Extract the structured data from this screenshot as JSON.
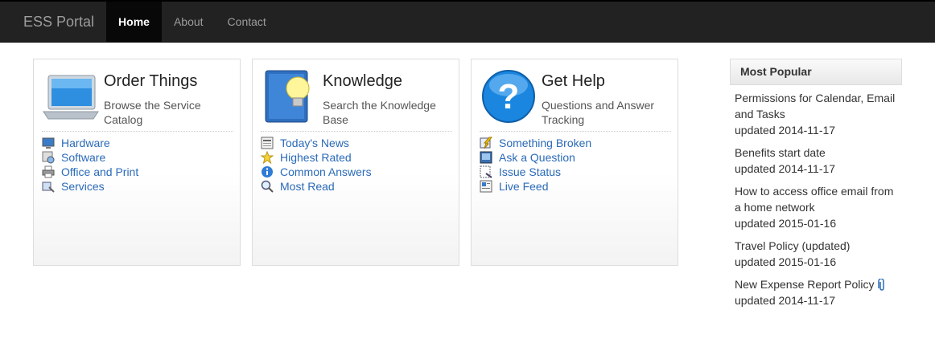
{
  "navbar": {
    "brand": "ESS Portal",
    "items": [
      {
        "label": "Home",
        "active": true
      },
      {
        "label": "About",
        "active": false
      },
      {
        "label": "Contact",
        "active": false
      }
    ]
  },
  "panels": [
    {
      "title": "Order Things",
      "subtitle": "Browse the Service Catalog",
      "icon": "laptop-icon",
      "links": [
        {
          "label": "Hardware",
          "icon": "monitor-icon"
        },
        {
          "label": "Software",
          "icon": "software-icon"
        },
        {
          "label": "Office and Print",
          "icon": "printer-icon"
        },
        {
          "label": "Services",
          "icon": "services-icon"
        }
      ]
    },
    {
      "title": "Knowledge",
      "subtitle": "Search the Knowledge Base",
      "icon": "book-lightbulb-icon",
      "links": [
        {
          "label": "Today's News",
          "icon": "news-icon"
        },
        {
          "label": "Highest Rated",
          "icon": "star-icon"
        },
        {
          "label": "Common Answers",
          "icon": "info-icon"
        },
        {
          "label": "Most Read",
          "icon": "magnifier-icon"
        }
      ]
    },
    {
      "title": "Get Help",
      "subtitle": "Questions and Answer Tracking",
      "icon": "question-icon",
      "links": [
        {
          "label": "Something Broken",
          "icon": "broken-icon"
        },
        {
          "label": "Ask a Question",
          "icon": "ask-icon"
        },
        {
          "label": "Issue Status",
          "icon": "status-icon"
        },
        {
          "label": "Live Feed",
          "icon": "feed-icon"
        }
      ]
    }
  ],
  "sidebar": {
    "heading": "Most Popular",
    "items": [
      {
        "title": "Permissions for Calendar, Email and Tasks",
        "date": "updated 2014-11-17",
        "attachment": false
      },
      {
        "title": "Benefits start date",
        "date": "updated 2014-11-17",
        "attachment": false
      },
      {
        "title": "How to access office email from a home network",
        "date": "updated 2015-01-16",
        "attachment": false
      },
      {
        "title": "Travel Policy (updated)",
        "date": "updated 2015-01-16",
        "attachment": false
      },
      {
        "title": "New Expense Report Policy",
        "date": "updated 2014-11-17",
        "attachment": true
      }
    ]
  },
  "colors": {
    "navbar": "#222222",
    "link": "#2a6ab8",
    "active_tab": "#080808"
  }
}
